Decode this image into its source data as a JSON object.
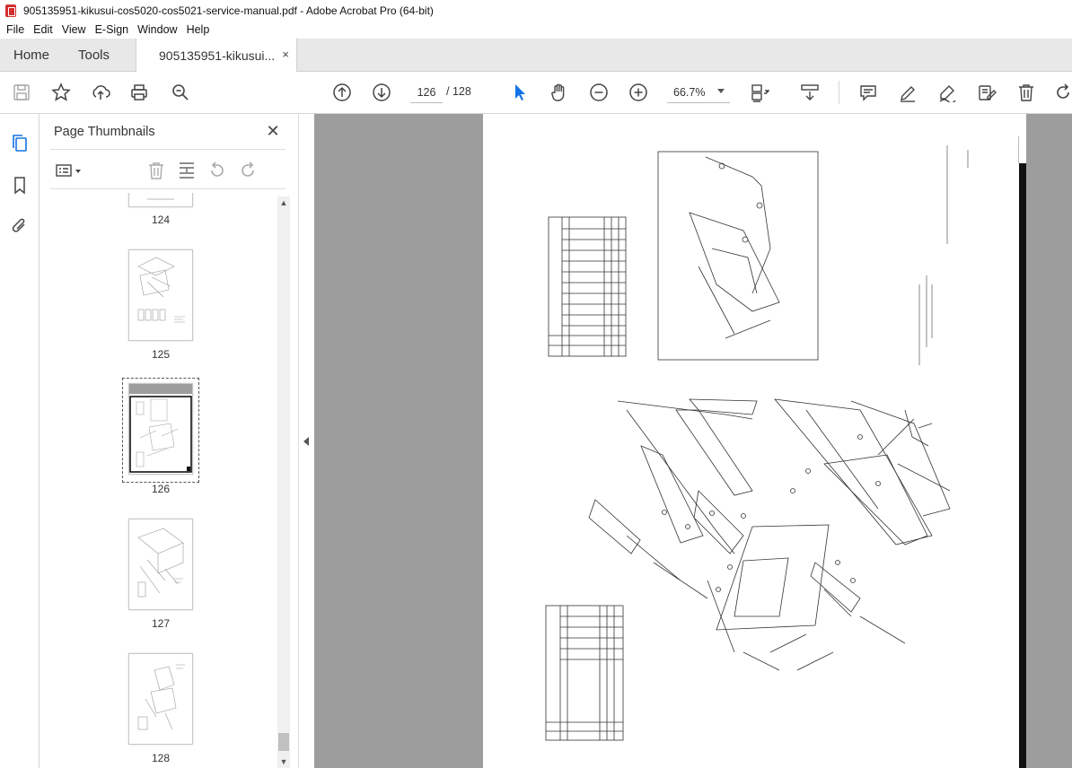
{
  "window": {
    "title": "905135951-kikusui-cos5020-cos5021-service-manual.pdf - Adobe Acrobat Pro (64-bit)"
  },
  "menu": [
    "File",
    "Edit",
    "View",
    "E-Sign",
    "Window",
    "Help"
  ],
  "tabs": {
    "home": "Home",
    "tools": "Tools",
    "document": "905135951-kikusui...",
    "close_glyph": "×"
  },
  "toolbar": {
    "current_page": "126",
    "total_pages": "/ 128",
    "zoom": "66.7%"
  },
  "thumbnails_panel": {
    "title": "Page Thumbnails",
    "close_glyph": "✕",
    "pages": [
      {
        "label": "124",
        "selected": false
      },
      {
        "label": "125",
        "selected": false
      },
      {
        "label": "126",
        "selected": true
      },
      {
        "label": "127",
        "selected": false
      },
      {
        "label": "128",
        "selected": false
      }
    ]
  },
  "colors": {
    "accent": "#1473e6",
    "doc_background": "#9d9d9d",
    "tab_bar": "#e8e8e8"
  },
  "icons": {
    "toolbar": [
      "save-icon",
      "star-icon",
      "upload-icon",
      "print-icon",
      "zoom-search-icon",
      "page-up-icon",
      "page-down-icon",
      "select-arrow-icon",
      "hand-icon",
      "zoom-out-icon",
      "zoom-in-icon",
      "fit-page-icon",
      "scroll-mode-icon",
      "comment-icon",
      "highlight-icon",
      "sign-icon",
      "edit-pdf-icon",
      "delete-icon",
      "rotate-icon"
    ],
    "rail": [
      "page-thumbnails-icon",
      "bookmark-icon",
      "attachment-icon"
    ]
  }
}
